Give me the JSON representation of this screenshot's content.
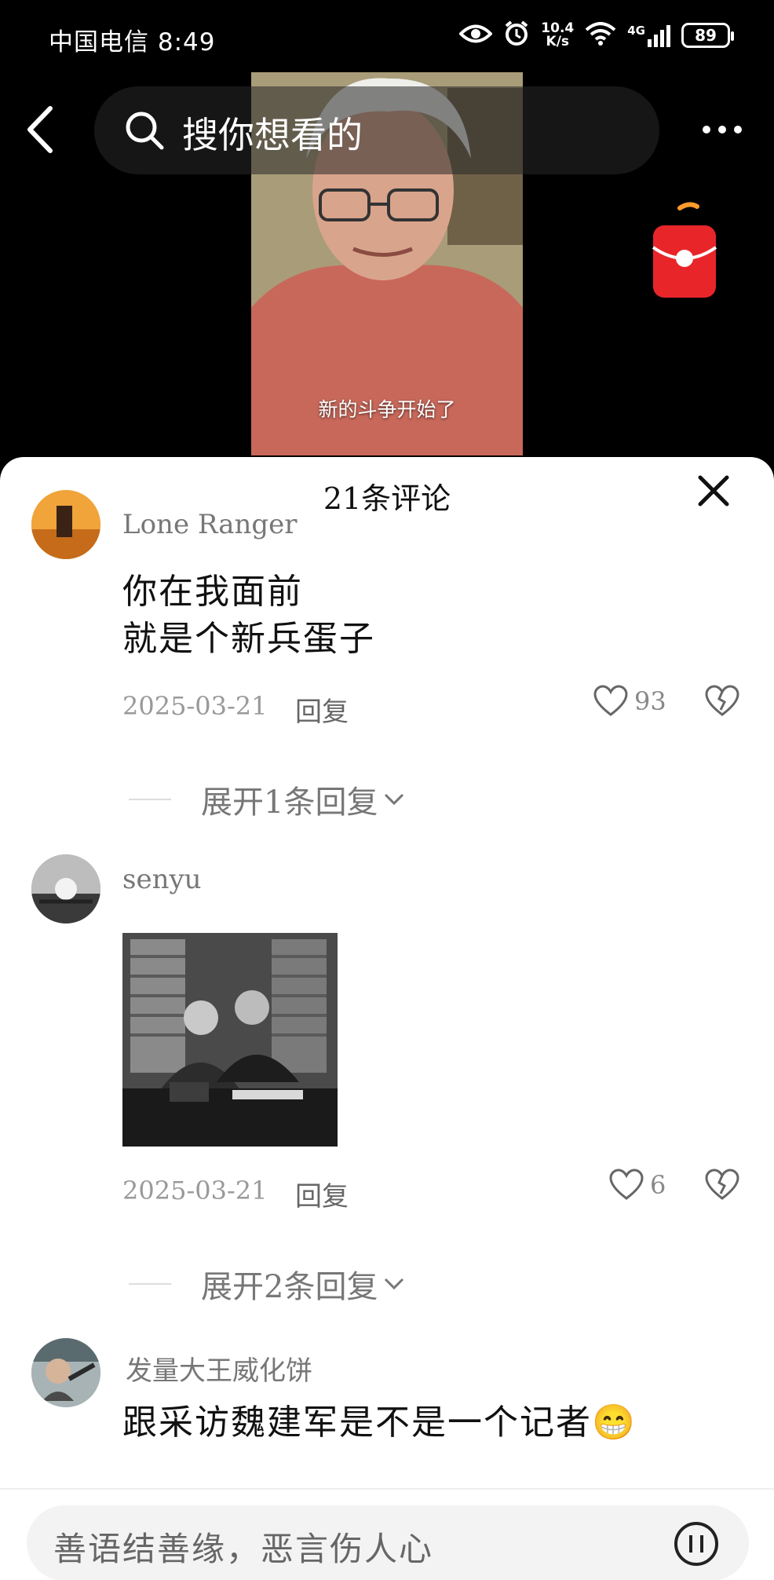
{
  "status_bar": {
    "carrier": "中国电信",
    "time": "8:49",
    "net_speed_value": "10.4",
    "net_speed_unit": "K/s",
    "network": "4G",
    "battery": "89"
  },
  "search": {
    "placeholder": "搜你想看的"
  },
  "video": {
    "subtitle": "新的斗争开始了"
  },
  "comments_panel": {
    "count_label": "21条评论",
    "comments": [
      {
        "username": "Lone Ranger",
        "lines": [
          "你在我面前",
          "就是个新兵蛋子"
        ],
        "date": "2025-03-21",
        "reply_label": "回复",
        "likes": "93",
        "expand_label": "展开1条回复"
      },
      {
        "username": "senyu",
        "date": "2025-03-21",
        "reply_label": "回复",
        "likes": "6",
        "expand_label": "展开2条回复"
      },
      {
        "username": "发量大王威化饼",
        "lines": [
          "跟采访魏建军是不是一个记者"
        ],
        "emoji": "😁"
      }
    ]
  },
  "input": {
    "placeholder": "善语结善缘，恶言伤人心"
  },
  "colors": {
    "background": "#000000",
    "sheet": "#ffffff",
    "red_packet": "#e8262a"
  }
}
